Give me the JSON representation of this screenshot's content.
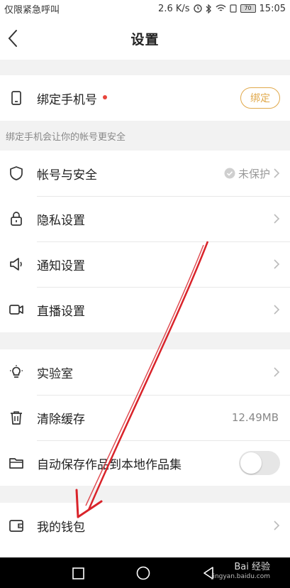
{
  "status_bar": {
    "carrier": "仅限紧急呼叫",
    "speed": "2.6 K/s",
    "battery": "70",
    "time": "15:05"
  },
  "header": {
    "title": "设置"
  },
  "phone_binding": {
    "label": "绑定手机号",
    "button": "绑定",
    "hint": "绑定手机会让你的帐号更安全"
  },
  "menu_group_1": [
    {
      "label": "帐号与安全",
      "status": "未保护"
    },
    {
      "label": "隐私设置"
    },
    {
      "label": "通知设置"
    },
    {
      "label": "直播设置"
    }
  ],
  "menu_group_2": [
    {
      "label": "实验室"
    },
    {
      "label": "清除缓存",
      "value": "12.49MB"
    },
    {
      "label": "自动保存作品到本地作品集",
      "toggle_on": false
    }
  ],
  "menu_group_3": [
    {
      "label": "我的钱包"
    }
  ],
  "watermark": {
    "main": "Bai 经验",
    "sub": "jingyan.baidu.com"
  },
  "colors": {
    "accent": "#e0a84a",
    "badge": "#e8453c",
    "annotation": "#d9232a"
  },
  "icons": {
    "back": "chevron-left-icon",
    "phone": "phone-icon",
    "shield": "shield-icon",
    "lock": "lock-icon",
    "speaker": "speaker-icon",
    "camera": "video-camera-icon",
    "bulb": "lightbulb-icon",
    "trash": "trash-icon",
    "folder": "folder-icon",
    "wallet": "wallet-icon"
  }
}
